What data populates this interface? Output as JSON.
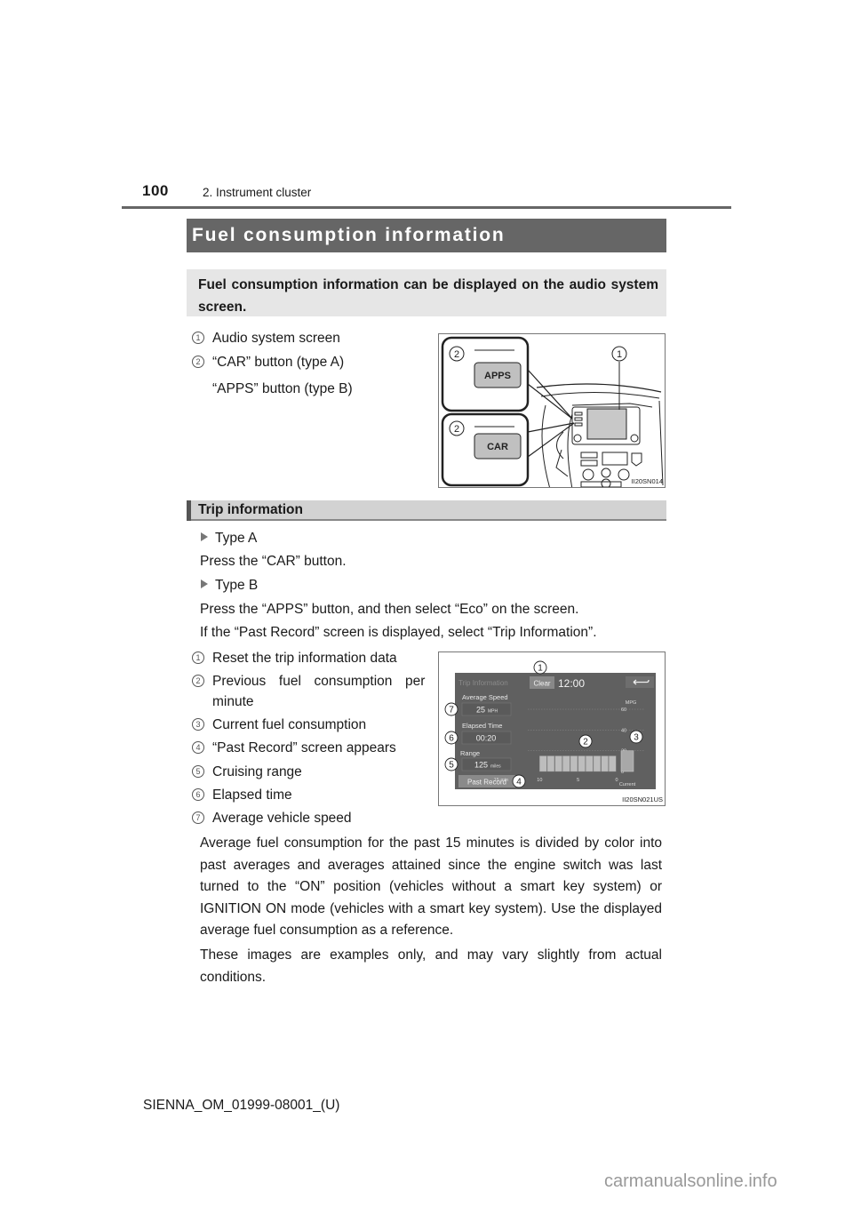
{
  "header": {
    "page_number": "100",
    "chapter": "2. Instrument cluster"
  },
  "section": {
    "title": "Fuel consumption information",
    "intro": "Fuel consumption information can be displayed on the audio system screen."
  },
  "figure1": {
    "callouts": [
      {
        "num": "1",
        "label": "Audio system screen"
      },
      {
        "num": "2",
        "label": "“CAR” button (type A)",
        "continuation": "“APPS” button (type B)"
      }
    ],
    "buttons": {
      "apps": "APPS",
      "car": "CAR"
    },
    "markers": [
      "2",
      "2",
      "1"
    ],
    "code": "II20SN014"
  },
  "trip": {
    "heading": "Trip information",
    "type_a_label": "Type A",
    "type_a_text": "Press the “CAR” button.",
    "type_b_label": "Type B",
    "type_b_text": "Press the “APPS” button, and then select “Eco” on the screen.",
    "past_record_note": "If the “Past Record” screen is displayed, select “Trip Information”.",
    "callouts": [
      {
        "num": "1",
        "label": "Reset the trip information data"
      },
      {
        "num": "2",
        "label": "Previous  fuel  consumption  per",
        "continuation": "minute"
      },
      {
        "num": "3",
        "label": "Current fuel consumption"
      },
      {
        "num": "4",
        "label": "“Past Record” screen appears"
      },
      {
        "num": "5",
        "label": "Cruising range"
      },
      {
        "num": "6",
        "label": "Elapsed time"
      },
      {
        "num": "7",
        "label": "Average vehicle speed"
      }
    ],
    "note1": "Average fuel consumption for the past 15 minutes is divided by color into past averages and averages attained since the engine switch was last turned to the “ON” position (vehicles without a smart key system) or IGNITION ON mode (vehicles with a smart key system). Use the displayed average fuel consumption as a reference.",
    "note2": "These images are examples only, and may vary slightly from actual conditions."
  },
  "screen": {
    "title": "Trip Information",
    "clear": "Clear",
    "clock": "12:00",
    "back_icon": "return-arrow",
    "avg_speed_label": "Average Speed",
    "avg_speed_value": "25",
    "avg_speed_unit": "MPH",
    "elapsed_label": "Elapsed Time",
    "elapsed_value": "00:20",
    "range_label": "Range",
    "range_value": "125",
    "range_unit": "miles",
    "past_record": "Past Record",
    "unit": "MPG",
    "y_ticks": [
      "60",
      "40",
      "20",
      "0"
    ],
    "x_ticks": [
      "15 min",
      "10",
      "5",
      "0"
    ],
    "current_label": "Current",
    "markers": [
      "1",
      "2",
      "3",
      "4",
      "5",
      "6",
      "7"
    ],
    "code": "II20SN021US",
    "bar_values_mpg": [
      15,
      15,
      15,
      15,
      15,
      15,
      15,
      15,
      15,
      15
    ],
    "current_mpg": 20
  },
  "footer": {
    "doc_id": "SIENNA_OM_01999-08001_(U)",
    "watermark": "carmanualsonline.info"
  }
}
